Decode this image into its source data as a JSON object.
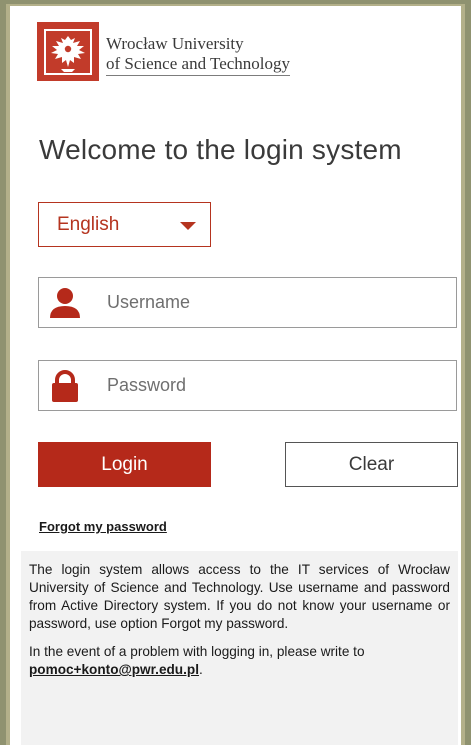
{
  "brand": {
    "name_line1": "Wrocław University",
    "name_line2": "of Science and Technology"
  },
  "title": "Welcome to the login system",
  "language": {
    "selected": "English"
  },
  "username": {
    "placeholder": "Username",
    "icon": "user-icon"
  },
  "password": {
    "placeholder": "Password",
    "icon": "lock-icon"
  },
  "buttons": {
    "login": "Login",
    "clear": "Clear"
  },
  "forgot_password": "Forgot my password",
  "info": {
    "paragraph1": "The login system allows access to the IT services of Wrocław University of Science and Technology. Use username and password from Active Directory system. If you do not know your username or password, use option Forgot my password.",
    "paragraph2_prefix": "In the event of a problem with logging in, please write to ",
    "email": "pomoc+konto@pwr.edu.pl",
    "paragraph2_suffix": "."
  },
  "colors": {
    "accent": "#b5291a",
    "background": "#b3b08a"
  }
}
